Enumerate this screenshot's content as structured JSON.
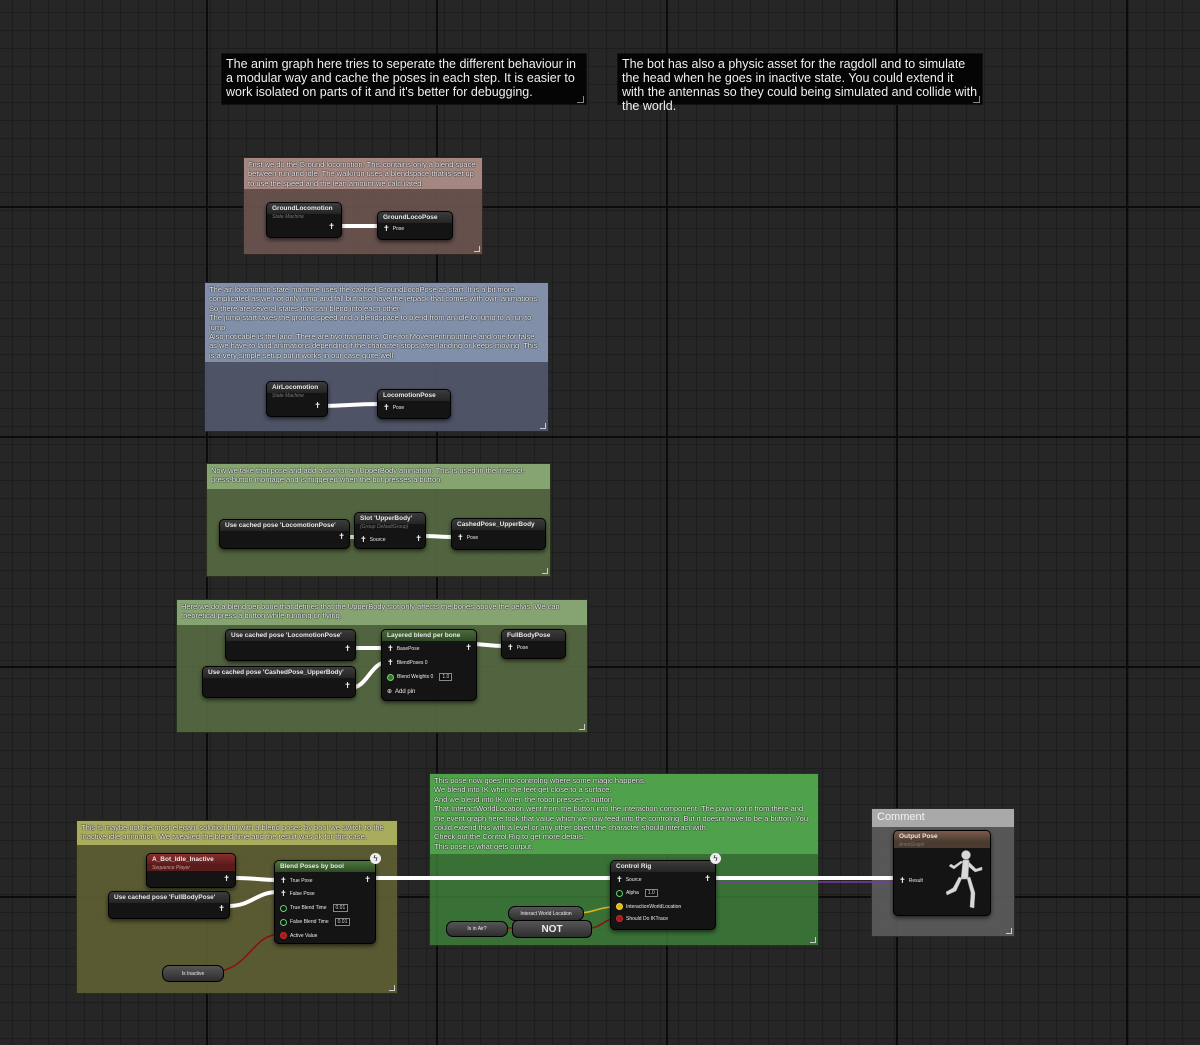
{
  "notes": {
    "top_left": "The anim graph here tries to seperate the different behaviour in a modular way and cache the poses in each step. It is easier to work isolated on parts of it and it's better for debugging.",
    "top_right": "The bot has also a physic asset for the ragdoll and to simulate the head when he goes in inactive state. You could extend it with the antennas so they could being simulated and collide with the world."
  },
  "comments": {
    "ground": "First we do the Ground locomotion. This contains only a blend space between run and idle. The walk/run uses a blendspace that is set up to use the speed and the lean amount we calculated.",
    "air": "The air locomotion state machine uses the cached GroundLocoPose as start. It is a bit more complicated as we not only jump and fall but also have the jetpack that comes with own animations. So there are several states that can blend into each other.\nThe jump start takes the ground speed and a blendspace to blend from an idle to jump to a run to jump.\nAlso noticable is the land. There are two transitions. One for MovementInput true and one for false as we have to land animations depending if the character stops after landing or keeps moving. This is a very simple setup but it works in our case quite well.",
    "slot": "Now we take that pose and add a slot for an UpperBody animation. This is used in the interact-press-button montage and is triggered when the bot presses a button.",
    "blend": "Here we do a blend per bone that defines that the UpperBody slot only affects the bones above the pelvis. We can theoretical press a button while running or flying.",
    "inactive": "This is maybe not the most elegant solution but with a blend poses by bool we switch to the inactive idle animation. We tweaked the blend time and the result was ok for this case.",
    "rig": "This pose now goes into controlrig where some magic happens.\nWe blend into IK when the feet get close to a surface.\nAnd we blend into IK when the robot presses a button.\nThat InteractWorldLocation went from the button into the interaction component. The pawn got it from there and the event graph here took that value which we now feed into the controlrig. But it doesnt have to be a button. You could extend this with a level or any other object the character should interact with.\nCheck out the Control Rig to get more details.\nThis pose is what gets output.",
    "output": "Comment"
  },
  "nodes": {
    "ground_sm": {
      "title": "GroundLocomotion",
      "sub": "State Machine"
    },
    "ground_cache": {
      "title": "GroundLocoPose",
      "pin": "Pose"
    },
    "air_sm": {
      "title": "AirLocomotion",
      "sub": "State Machine"
    },
    "air_cache": {
      "title": "LocomotionPose",
      "pin": "Pose"
    },
    "use_loco": {
      "title": "Use cached pose 'LocomotionPose'"
    },
    "slot": {
      "title": "Slot 'UpperBody'",
      "sub": "(Group DefaultGroup)",
      "pin": "Source"
    },
    "cached_upper": {
      "title": "CashedPose_UpperBody",
      "pin": "Pose"
    },
    "use_loco2": {
      "title": "Use cached pose 'LocomotionPose'"
    },
    "use_upper": {
      "title": "Use cached pose 'CashedPose_UpperBody'"
    },
    "layered": {
      "title": "Layered blend per bone",
      "pins": [
        "BasePose",
        "BlendPoses 0",
        "Blend Weights 0"
      ],
      "weight": "1.0",
      "add_pin": "Add pin"
    },
    "fullbody": {
      "title": "FullBodyPose",
      "pin": "Pose"
    },
    "idle": {
      "title": "A_Bot_Idle_Inactive",
      "sub": "Sequence Player"
    },
    "use_full": {
      "title": "Use cached pose 'FullBodyPose'"
    },
    "blend_bool": {
      "title": "Blend Poses by bool",
      "pins": [
        "True Pose",
        "False Pose",
        "True Blend Time",
        "False Blend Time",
        "Active Value"
      ],
      "true_time": "0.01",
      "false_time": "0.01"
    },
    "is_inactive": {
      "title": "Is Inactive"
    },
    "control_rig": {
      "title": "Control Rig",
      "pins": [
        "Source",
        "Alpha",
        "InteractionWorldLocation",
        "Should Do IKTrace"
      ],
      "alpha": "1.0"
    },
    "interact_loc": {
      "title": "Interact World Location"
    },
    "is_in_air": {
      "title": "Is in Air?"
    },
    "not": {
      "title": "NOT"
    },
    "output": {
      "title": "Output Pose",
      "sub": "AnimGraph",
      "pin": "Result"
    }
  },
  "colors": {
    "ground_comment": "#6d5551",
    "air_comment": "#53596d",
    "green_comment": "#566b43",
    "rig_comment": "#3f8a3c",
    "inactive_comment": "#5f6134",
    "output_comment": "#5a5a5a",
    "pose_wire": "#ffffff",
    "bool_wire": "#8a1010",
    "vector_wire": "#d9b81c"
  },
  "icons": [
    "pose-icon",
    "circle-pin-icon",
    "lightning-icon",
    "running-figure-icon",
    "resize-grip-icon"
  ]
}
